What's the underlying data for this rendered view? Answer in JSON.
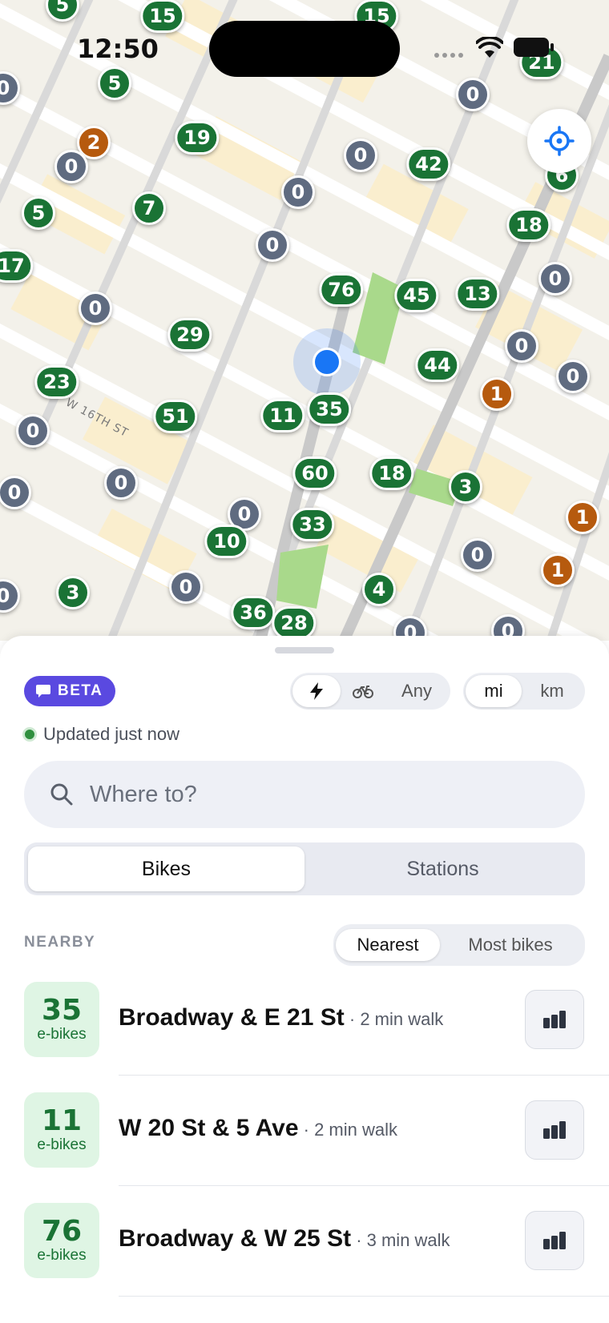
{
  "status_bar": {
    "time": "12:50",
    "wifi_icon": "wifi-icon",
    "battery_icon": "battery-icon"
  },
  "map": {
    "street_label": "W 16TH ST",
    "locate_icon": "crosshair-icon",
    "colors": {
      "available": "#1a7335",
      "low": "#b65a0e",
      "empty": "#5f6b80",
      "user": "#1976f5"
    },
    "pins": [
      {
        "label": "5",
        "color": "green"
      },
      {
        "label": "15",
        "color": "green"
      },
      {
        "label": "21",
        "color": "green"
      },
      {
        "label": "5",
        "color": "green"
      },
      {
        "label": "0",
        "color": "gray"
      },
      {
        "label": "0",
        "color": "gray"
      },
      {
        "label": "2",
        "color": "orange"
      },
      {
        "label": "0",
        "color": "gray"
      },
      {
        "label": "19",
        "color": "green"
      },
      {
        "label": "0",
        "color": "gray"
      },
      {
        "label": "42",
        "color": "green"
      },
      {
        "label": "6",
        "color": "green"
      },
      {
        "label": "5",
        "color": "green"
      },
      {
        "label": "7",
        "color": "green"
      },
      {
        "label": "0",
        "color": "gray"
      },
      {
        "label": "18",
        "color": "green"
      },
      {
        "label": "0",
        "color": "gray"
      },
      {
        "label": "17",
        "color": "green"
      },
      {
        "label": "0",
        "color": "gray"
      },
      {
        "label": "76",
        "color": "green"
      },
      {
        "label": "45",
        "color": "green"
      },
      {
        "label": "13",
        "color": "green"
      },
      {
        "label": "0",
        "color": "gray"
      },
      {
        "label": "29",
        "color": "green"
      },
      {
        "label": "0",
        "color": "gray"
      },
      {
        "label": "44",
        "color": "green"
      },
      {
        "label": "0",
        "color": "gray"
      },
      {
        "label": "23",
        "color": "green"
      },
      {
        "label": "1",
        "color": "orange"
      },
      {
        "label": "0",
        "color": "gray"
      },
      {
        "label": "51",
        "color": "green"
      },
      {
        "label": "11",
        "color": "green"
      },
      {
        "label": "35",
        "color": "green"
      },
      {
        "label": "60",
        "color": "green"
      },
      {
        "label": "18",
        "color": "green"
      },
      {
        "label": "3",
        "color": "green"
      },
      {
        "label": "0",
        "color": "gray"
      },
      {
        "label": "0",
        "color": "gray"
      },
      {
        "label": "0",
        "color": "gray"
      },
      {
        "label": "1",
        "color": "orange"
      },
      {
        "label": "10",
        "color": "green"
      },
      {
        "label": "33",
        "color": "green"
      },
      {
        "label": "0",
        "color": "gray"
      },
      {
        "label": "1",
        "color": "orange"
      },
      {
        "label": "3",
        "color": "green"
      },
      {
        "label": "0",
        "color": "gray"
      },
      {
        "label": "0",
        "color": "gray"
      },
      {
        "label": "4",
        "color": "green"
      },
      {
        "label": "36",
        "color": "green"
      },
      {
        "label": "28",
        "color": "green"
      },
      {
        "label": "0",
        "color": "gray"
      },
      {
        "label": "0",
        "color": "gray"
      }
    ]
  },
  "sheet": {
    "beta_label": "BETA",
    "beta_icon": "message-icon",
    "type_filter": {
      "options": [
        "lightning-icon",
        "bike-icon",
        "Any"
      ],
      "any_label": "Any",
      "selected": "lightning-icon"
    },
    "units": {
      "mi": "mi",
      "km": "km",
      "selected": "mi"
    },
    "updated_text": "Updated just now",
    "search": {
      "placeholder": "Where to?",
      "value": "",
      "icon": "search-icon"
    },
    "tabs": {
      "bikes": "Bikes",
      "stations": "Stations",
      "selected": "Bikes"
    },
    "section_label": "NEARBY",
    "sort": {
      "nearest": "Nearest",
      "most_bikes": "Most bikes",
      "selected": "Nearest"
    },
    "stations": [
      {
        "count": "35",
        "unit": "e-bikes",
        "name": "Broadway & E 21 St",
        "walk": " · 2 min walk"
      },
      {
        "count": "11",
        "unit": "e-bikes",
        "name": "W 20 St & 5 Ave",
        "walk": " · 2 min walk"
      },
      {
        "count": "76",
        "unit": "e-bikes",
        "name": "Broadway & W 25 St",
        "walk": " · 3 min walk"
      }
    ],
    "stats_icon": "bar-chart-icon"
  }
}
